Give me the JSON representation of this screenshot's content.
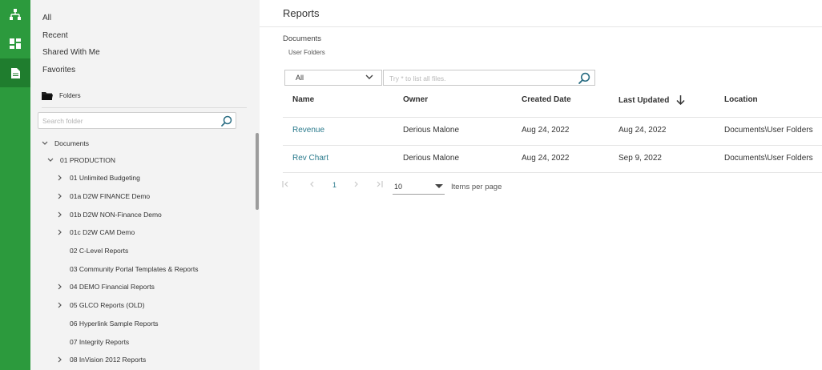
{
  "rail": {
    "items": [
      {
        "icon": "hierarchy-icon"
      },
      {
        "icon": "dashboard-icon"
      },
      {
        "icon": "document-icon",
        "active": true
      }
    ]
  },
  "sidebar": {
    "quick_filters": [
      "All",
      "Recent",
      "Shared With Me",
      "Favorites"
    ],
    "folders_label": "Folders",
    "search_placeholder": "Search folder",
    "tree": [
      {
        "label": "Documents",
        "expanded": true
      },
      {
        "label": "01 PRODUCTION",
        "expanded": true
      },
      {
        "label": "01 Unlimited Budgeting",
        "expandable": true
      },
      {
        "label": "01a D2W FINANCE Demo",
        "expandable": true
      },
      {
        "label": "01b D2W NON-Finance Demo",
        "expandable": true
      },
      {
        "label": "01c D2W CAM Demo",
        "expandable": true
      },
      {
        "label": "02 C-Level Reports",
        "expandable": false
      },
      {
        "label": "03 Community Portal Templates & Reports",
        "expandable": false
      },
      {
        "label": "04 DEMO Financial Reports",
        "expandable": true
      },
      {
        "label": "05 GLCO Reports (OLD)",
        "expandable": true
      },
      {
        "label": "06 Hyperlink Sample Reports",
        "expandable": false
      },
      {
        "label": "07 Integrity Reports",
        "expandable": false
      },
      {
        "label": "08 InVision 2012 Reports",
        "expandable": true
      }
    ]
  },
  "main": {
    "title": "Reports",
    "breadcrumb": [
      "Documents",
      "User Folders"
    ],
    "filter": {
      "selected": "All"
    },
    "search": {
      "placeholder": "Try * to list all files.",
      "value": ""
    },
    "table": {
      "columns": [
        "Name",
        "Owner",
        "Created Date",
        "Last Updated",
        "Location"
      ],
      "sort": {
        "column": "Last Updated",
        "direction": "descending"
      },
      "rows": [
        {
          "name": "Revenue",
          "owner": "Derious Malone",
          "created": "Aug 24, 2022",
          "updated": "Aug 24, 2022",
          "location": "Documents\\User Folders"
        },
        {
          "name": "Rev Chart",
          "owner": "Derious Malone",
          "created": "Aug 24, 2022",
          "updated": "Sep 9, 2022",
          "location": "Documents\\User Folders"
        }
      ]
    },
    "pagination": {
      "current_page": "1",
      "page_size": "10",
      "page_size_label": "Items per page"
    }
  },
  "colors": {
    "rail_green": "#2c9a3d",
    "rail_active": "#1f7d2e",
    "link_teal": "#2a7a8c",
    "sidebar_bg": "#f3f3f3"
  }
}
